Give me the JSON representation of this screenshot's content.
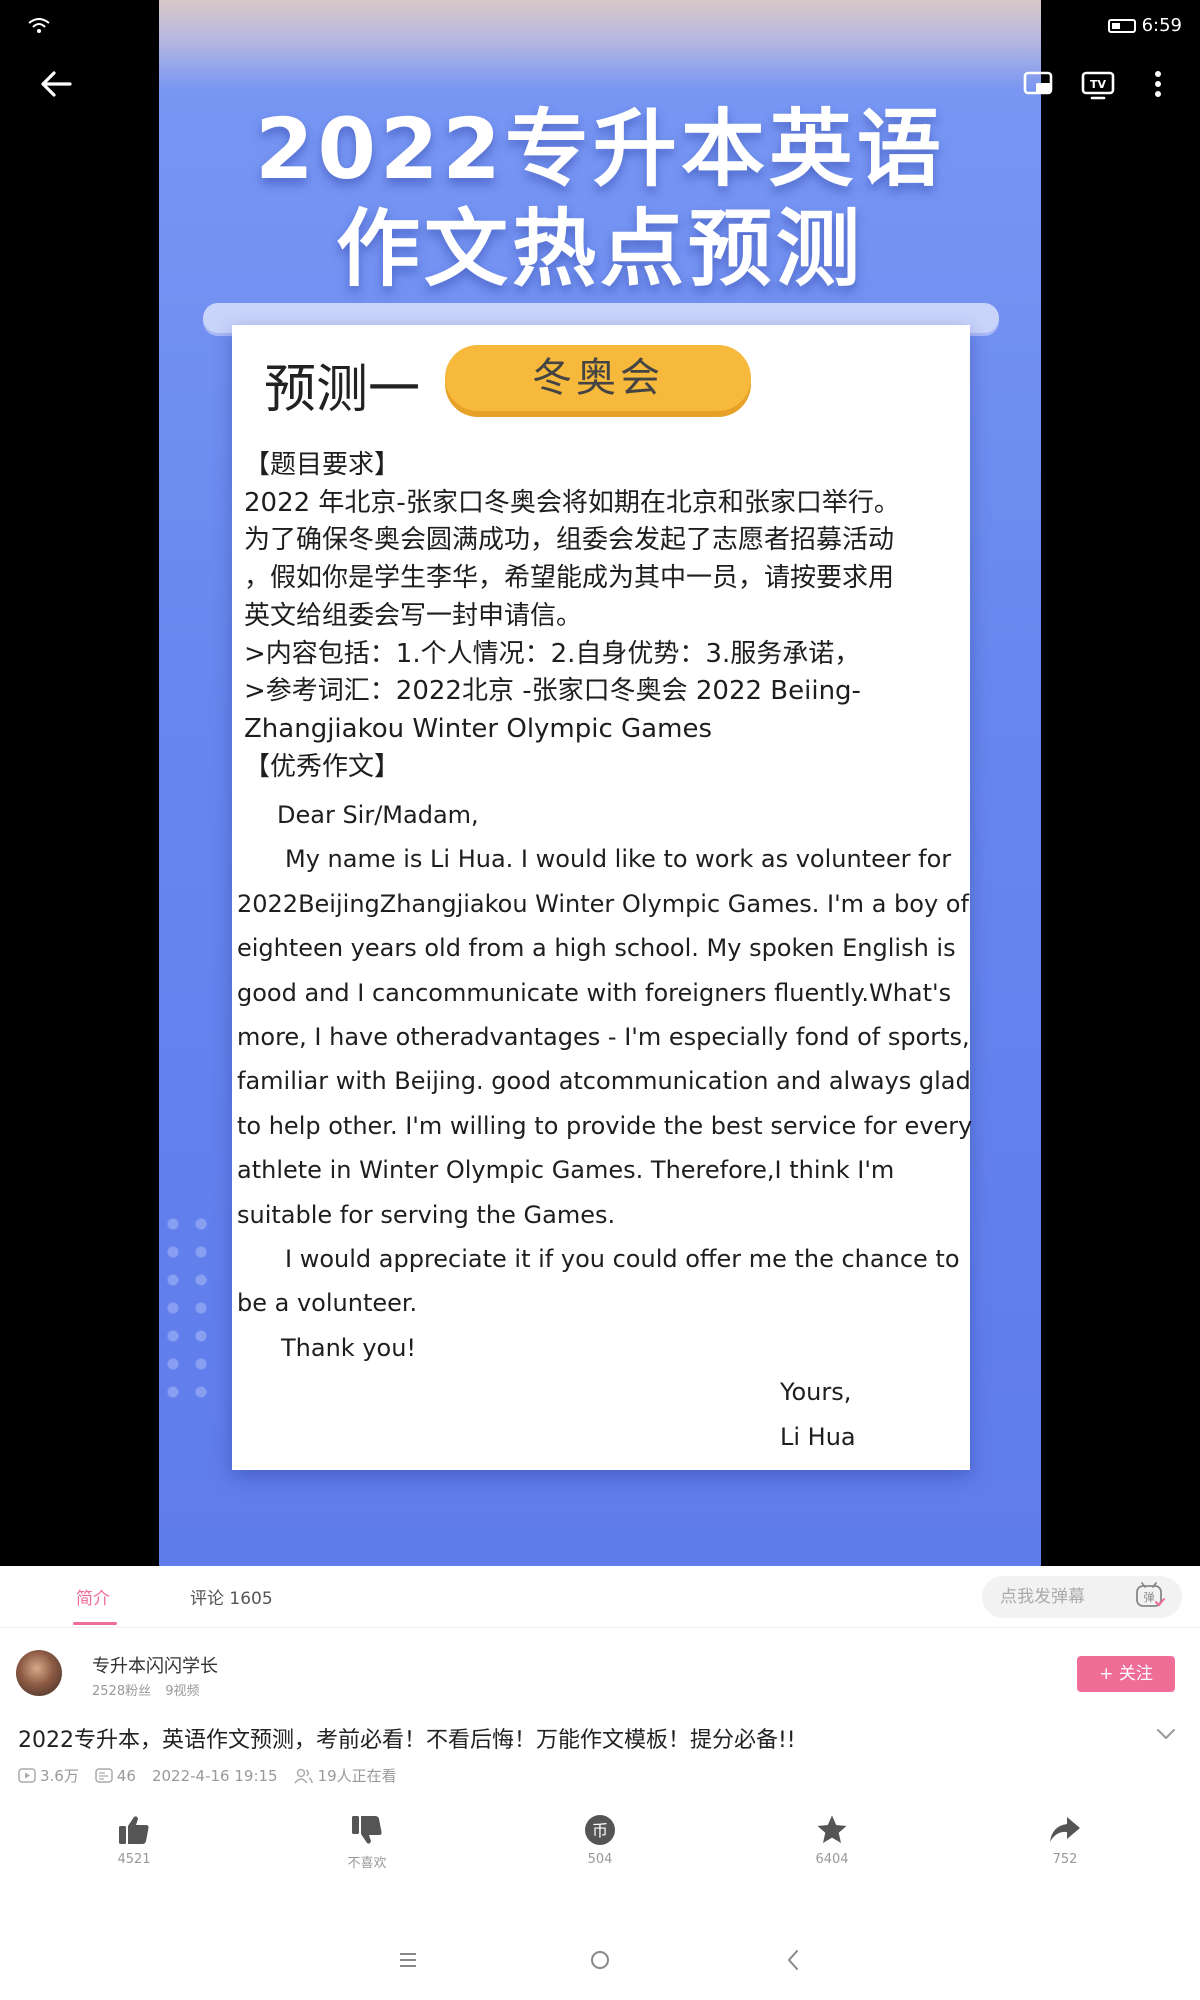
{
  "status_bar": {
    "time": "6:59"
  },
  "poster": {
    "title_line1": "2022专升本英语",
    "title_line2": "作文热点预测",
    "forecast_label": "预测一",
    "topic": "冬奥会",
    "prompt_lines": [
      "【题目要求】",
      "2022 年北京-张家口冬奥会将如期在北京和张家口举行。",
      "为了确保冬奥会圆满成功，组委会发起了志愿者招募活动",
      "，假如你是学生李华，希望能成为其中一员，请按要求用",
      "英文给组委会写一封申请信。",
      ">内容包括：1.个人情况：2.自身优势：3.服务承诺，",
      ">参考词汇：2022北京 -张家口冬奥会 2022 Beiing-",
      "Zhangjiakou Winter Olympic Games",
      "【优秀作文】"
    ],
    "greeting": "Dear Sir/Madam,",
    "essay_lines": [
      "My name is Li Hua. I would like to work as  volunteer for",
      "2022BeijingZhangjiakou Winter Olympic Games. I'm a boy of",
      "eighteen years old from a high school. My spoken English is",
      "good and I cancommunicate with foreigners fluently.What's",
      "more, I have otheradvantages - I'm especially fond of sports,",
      "familiar with Beijing. good atcommunication and always glad",
      "to help other. I'm willing to provide the best service for every",
      "athlete in Winter Olympic Games. Therefore,I think I'm",
      "suitable for serving the Games."
    ],
    "closing_line1": "I would appreciate it if you could offer me the chance to",
    "closing_line2": "be a volunteer.",
    "thanks": "Thank you!",
    "signoff": "Yours,",
    "signature": "Li Hua"
  },
  "tabs": {
    "intro": "简介",
    "comments": "评论 1605"
  },
  "danmaku": {
    "placeholder": "点我发弹幕",
    "button_icon": "danmaku-icon"
  },
  "uploader": {
    "name": "专升本闪闪学长",
    "fans": "2528粉丝",
    "videos": "9视频",
    "follow_label": "+ 关注"
  },
  "video": {
    "title": "2022专升本，英语作文预测，考前必看！不看后悔！万能作文模板！提分必备!!",
    "views": "3.6万",
    "danmaku_count": "46",
    "date": "2022-4-16 19:15",
    "watching": "19人正在看"
  },
  "actions": {
    "like": "4521",
    "dislike": "不喜欢",
    "coin": "504",
    "favorite": "6404",
    "share": "752"
  },
  "colors": {
    "accent": "#f06d97",
    "poster_blue": "#6787ef",
    "pill": "#f6b93b"
  }
}
